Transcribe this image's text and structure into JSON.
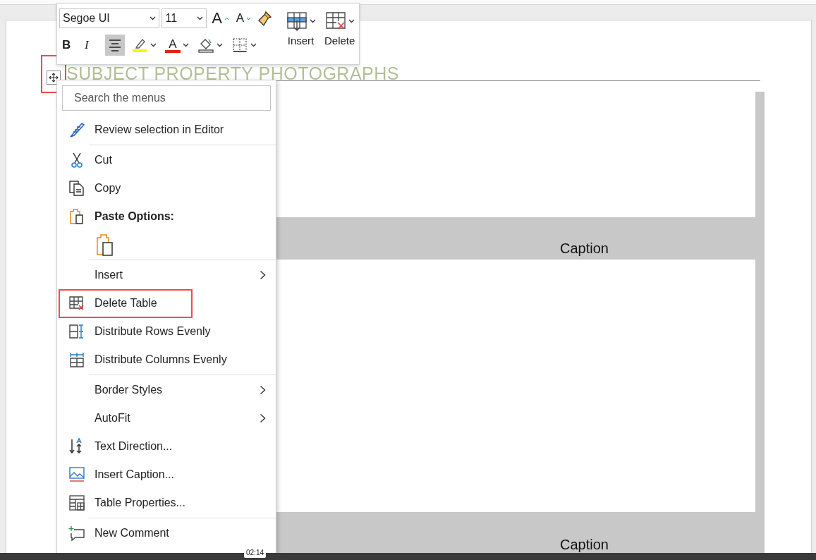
{
  "mini_toolbar": {
    "font": "Segoe UI",
    "size": "11",
    "grow_font": "A",
    "shrink_font": "A",
    "bold": "B",
    "italic": "I",
    "center_align": {
      "selected": true
    },
    "font_color": "A",
    "insert": "Insert",
    "delete": "Delete"
  },
  "document": {
    "heading": "SUBJECT PROPERTY PHOTOGRAPHS",
    "table_handle": {
      "highlighted": true
    },
    "rows": [
      {
        "kind": "photo"
      },
      {
        "kind": "caption",
        "caption": "Caption"
      },
      {
        "kind": "photo"
      },
      {
        "kind": "caption",
        "caption": "Caption"
      }
    ]
  },
  "context_menu": {
    "search": {
      "placeholder": "Search the menus"
    },
    "sections": [
      [
        {
          "kind": "command",
          "label": "Review selection in Editor",
          "submenu": false,
          "highlighted": false
        }
      ],
      [
        {
          "kind": "command",
          "label": "Cut",
          "submenu": false,
          "highlighted": false
        },
        {
          "kind": "command",
          "label": "Copy",
          "submenu": false,
          "highlighted": false
        },
        {
          "kind": "heading",
          "label": "Paste Options:",
          "submenu": false,
          "highlighted": false
        },
        {
          "kind": "paste-option",
          "submenu": false,
          "highlighted": false
        }
      ],
      [
        {
          "kind": "command",
          "label": "Insert",
          "submenu": true,
          "highlighted": false
        },
        {
          "kind": "command",
          "label": "Delete Table",
          "submenu": false,
          "highlighted": true
        },
        {
          "kind": "command",
          "label": "Distribute Rows Evenly",
          "submenu": false,
          "highlighted": false
        },
        {
          "kind": "command",
          "label": "Distribute Columns Evenly",
          "submenu": false,
          "highlighted": false
        }
      ],
      [
        {
          "kind": "command",
          "label": "Border Styles",
          "submenu": true,
          "highlighted": false
        },
        {
          "kind": "command",
          "label": "AutoFit",
          "submenu": true,
          "highlighted": false
        },
        {
          "kind": "command",
          "label": "Text Direction...",
          "submenu": false,
          "highlighted": false
        },
        {
          "kind": "command",
          "label": "Insert Caption...",
          "submenu": false,
          "highlighted": false
        },
        {
          "kind": "command",
          "label": "Table Properties...",
          "submenu": false,
          "highlighted": false
        }
      ],
      [
        {
          "kind": "command",
          "label": "New Comment",
          "submenu": false,
          "highlighted": false
        }
      ]
    ]
  },
  "video_bar": {
    "time": "02:14"
  }
}
